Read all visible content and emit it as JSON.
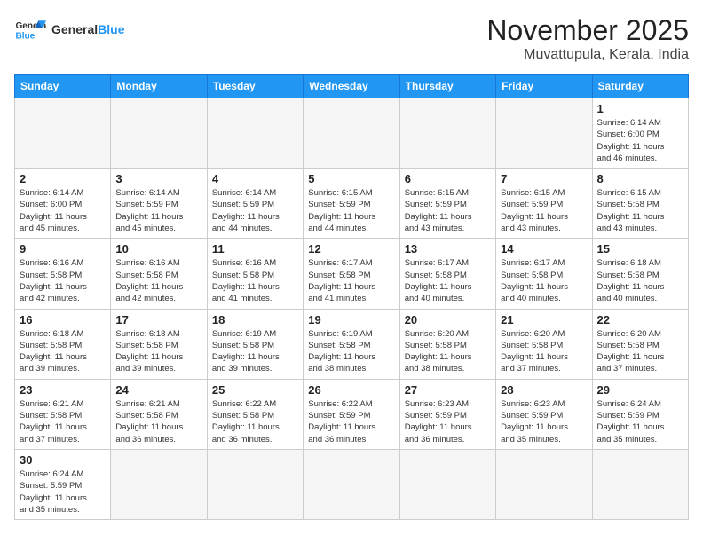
{
  "header": {
    "logo_text_general": "General",
    "logo_text_blue": "Blue",
    "month_title": "November 2025",
    "location": "Muvattupula, Kerala, India"
  },
  "weekdays": [
    "Sunday",
    "Monday",
    "Tuesday",
    "Wednesday",
    "Thursday",
    "Friday",
    "Saturday"
  ],
  "weeks": [
    [
      {
        "day": "",
        "info": ""
      },
      {
        "day": "",
        "info": ""
      },
      {
        "day": "",
        "info": ""
      },
      {
        "day": "",
        "info": ""
      },
      {
        "day": "",
        "info": ""
      },
      {
        "day": "",
        "info": ""
      },
      {
        "day": "1",
        "info": "Sunrise: 6:14 AM\nSunset: 6:00 PM\nDaylight: 11 hours\nand 46 minutes."
      }
    ],
    [
      {
        "day": "2",
        "info": "Sunrise: 6:14 AM\nSunset: 6:00 PM\nDaylight: 11 hours\nand 45 minutes."
      },
      {
        "day": "3",
        "info": "Sunrise: 6:14 AM\nSunset: 5:59 PM\nDaylight: 11 hours\nand 45 minutes."
      },
      {
        "day": "4",
        "info": "Sunrise: 6:14 AM\nSunset: 5:59 PM\nDaylight: 11 hours\nand 44 minutes."
      },
      {
        "day": "5",
        "info": "Sunrise: 6:15 AM\nSunset: 5:59 PM\nDaylight: 11 hours\nand 44 minutes."
      },
      {
        "day": "6",
        "info": "Sunrise: 6:15 AM\nSunset: 5:59 PM\nDaylight: 11 hours\nand 43 minutes."
      },
      {
        "day": "7",
        "info": "Sunrise: 6:15 AM\nSunset: 5:59 PM\nDaylight: 11 hours\nand 43 minutes."
      },
      {
        "day": "8",
        "info": "Sunrise: 6:15 AM\nSunset: 5:58 PM\nDaylight: 11 hours\nand 43 minutes."
      }
    ],
    [
      {
        "day": "9",
        "info": "Sunrise: 6:16 AM\nSunset: 5:58 PM\nDaylight: 11 hours\nand 42 minutes."
      },
      {
        "day": "10",
        "info": "Sunrise: 6:16 AM\nSunset: 5:58 PM\nDaylight: 11 hours\nand 42 minutes."
      },
      {
        "day": "11",
        "info": "Sunrise: 6:16 AM\nSunset: 5:58 PM\nDaylight: 11 hours\nand 41 minutes."
      },
      {
        "day": "12",
        "info": "Sunrise: 6:17 AM\nSunset: 5:58 PM\nDaylight: 11 hours\nand 41 minutes."
      },
      {
        "day": "13",
        "info": "Sunrise: 6:17 AM\nSunset: 5:58 PM\nDaylight: 11 hours\nand 40 minutes."
      },
      {
        "day": "14",
        "info": "Sunrise: 6:17 AM\nSunset: 5:58 PM\nDaylight: 11 hours\nand 40 minutes."
      },
      {
        "day": "15",
        "info": "Sunrise: 6:18 AM\nSunset: 5:58 PM\nDaylight: 11 hours\nand 40 minutes."
      }
    ],
    [
      {
        "day": "16",
        "info": "Sunrise: 6:18 AM\nSunset: 5:58 PM\nDaylight: 11 hours\nand 39 minutes."
      },
      {
        "day": "17",
        "info": "Sunrise: 6:18 AM\nSunset: 5:58 PM\nDaylight: 11 hours\nand 39 minutes."
      },
      {
        "day": "18",
        "info": "Sunrise: 6:19 AM\nSunset: 5:58 PM\nDaylight: 11 hours\nand 39 minutes."
      },
      {
        "day": "19",
        "info": "Sunrise: 6:19 AM\nSunset: 5:58 PM\nDaylight: 11 hours\nand 38 minutes."
      },
      {
        "day": "20",
        "info": "Sunrise: 6:20 AM\nSunset: 5:58 PM\nDaylight: 11 hours\nand 38 minutes."
      },
      {
        "day": "21",
        "info": "Sunrise: 6:20 AM\nSunset: 5:58 PM\nDaylight: 11 hours\nand 37 minutes."
      },
      {
        "day": "22",
        "info": "Sunrise: 6:20 AM\nSunset: 5:58 PM\nDaylight: 11 hours\nand 37 minutes."
      }
    ],
    [
      {
        "day": "23",
        "info": "Sunrise: 6:21 AM\nSunset: 5:58 PM\nDaylight: 11 hours\nand 37 minutes."
      },
      {
        "day": "24",
        "info": "Sunrise: 6:21 AM\nSunset: 5:58 PM\nDaylight: 11 hours\nand 36 minutes."
      },
      {
        "day": "25",
        "info": "Sunrise: 6:22 AM\nSunset: 5:58 PM\nDaylight: 11 hours\nand 36 minutes."
      },
      {
        "day": "26",
        "info": "Sunrise: 6:22 AM\nSunset: 5:59 PM\nDaylight: 11 hours\nand 36 minutes."
      },
      {
        "day": "27",
        "info": "Sunrise: 6:23 AM\nSunset: 5:59 PM\nDaylight: 11 hours\nand 36 minutes."
      },
      {
        "day": "28",
        "info": "Sunrise: 6:23 AM\nSunset: 5:59 PM\nDaylight: 11 hours\nand 35 minutes."
      },
      {
        "day": "29",
        "info": "Sunrise: 6:24 AM\nSunset: 5:59 PM\nDaylight: 11 hours\nand 35 minutes."
      }
    ],
    [
      {
        "day": "30",
        "info": "Sunrise: 6:24 AM\nSunset: 5:59 PM\nDaylight: 11 hours\nand 35 minutes."
      },
      {
        "day": "",
        "info": ""
      },
      {
        "day": "",
        "info": ""
      },
      {
        "day": "",
        "info": ""
      },
      {
        "day": "",
        "info": ""
      },
      {
        "day": "",
        "info": ""
      },
      {
        "day": "",
        "info": ""
      }
    ]
  ]
}
